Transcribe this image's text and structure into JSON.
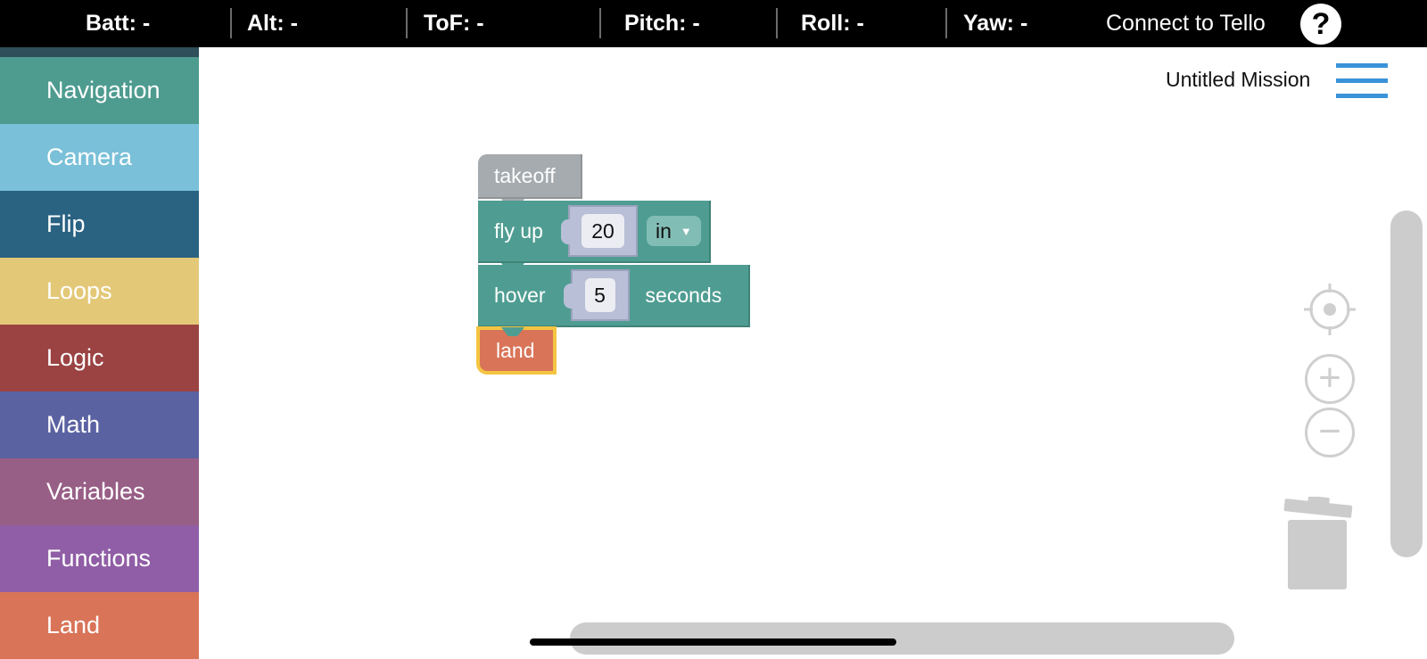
{
  "topbar": {
    "stats": [
      {
        "label": "Batt:",
        "value": "-"
      },
      {
        "label": "Alt:",
        "value": "-"
      },
      {
        "label": "ToF:",
        "value": "-"
      },
      {
        "label": "Pitch:",
        "value": "-"
      },
      {
        "label": "Roll:",
        "value": "-"
      },
      {
        "label": "Yaw:",
        "value": "-"
      }
    ],
    "connect_label": "Connect to Tello",
    "help_label": "?"
  },
  "sidebar": {
    "items": [
      {
        "label": "Navigation",
        "color": "#4e9b8f"
      },
      {
        "label": "Camera",
        "color": "#79c0d8"
      },
      {
        "label": "Flip",
        "color": "#2a6282"
      },
      {
        "label": "Loops",
        "color": "#e3c878"
      },
      {
        "label": "Logic",
        "color": "#9b4343"
      },
      {
        "label": "Math",
        "color": "#5b62a2"
      },
      {
        "label": "Variables",
        "color": "#975e86"
      },
      {
        "label": "Functions",
        "color": "#905ea6"
      },
      {
        "label": "Land",
        "color": "#d97458"
      }
    ]
  },
  "workspace": {
    "mission_title": "Untitled Mission",
    "blocks": {
      "takeoff": {
        "label": "takeoff"
      },
      "flyup": {
        "label": "fly up",
        "value": "20",
        "unit": "in"
      },
      "hover": {
        "label": "hover",
        "value": "5",
        "suffix": "seconds"
      },
      "land": {
        "label": "land"
      }
    }
  },
  "icons": {
    "menu": "hamburger-menu-icon",
    "help": "question-mark-icon",
    "recenter": "crosshair-target-icon",
    "zoom_in": "plus-icon",
    "zoom_out": "minus-icon",
    "trash": "trash-can-icon"
  },
  "colors": {
    "topbar_bg": "#000000",
    "navigation_block": "#4f9d92",
    "takeoff_block": "#a5abaf",
    "land_block": "#d97458",
    "selection_outline": "#f4c542",
    "menu_accent": "#3a93d8"
  }
}
